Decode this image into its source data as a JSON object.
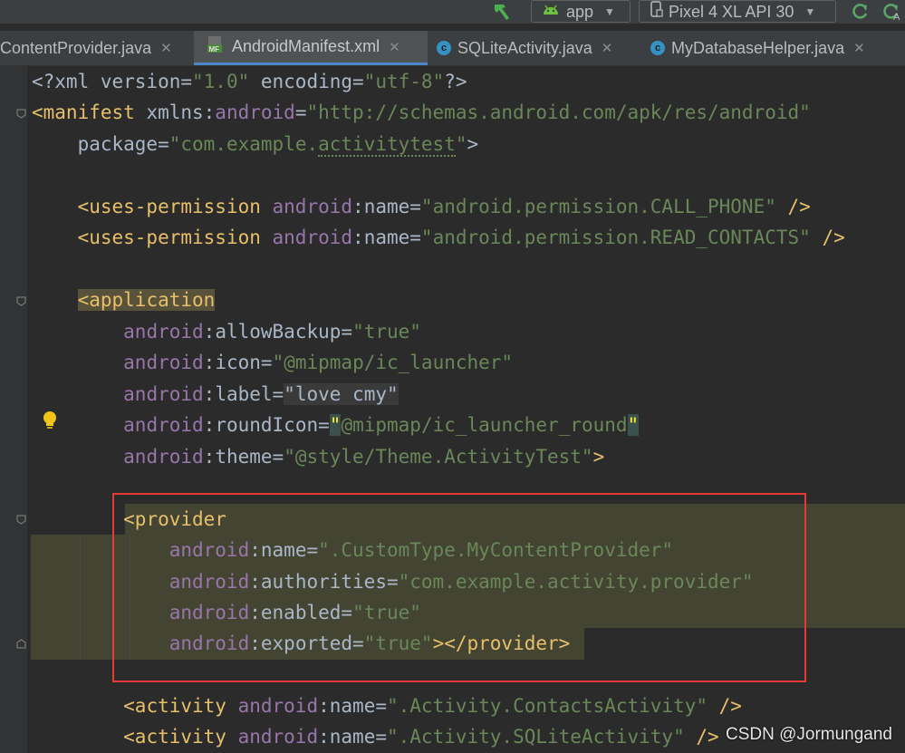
{
  "toolbar": {
    "run_config": "app",
    "device": "Pixel 4 XL API 30"
  },
  "tabs": [
    {
      "label": "ContentProvider.java",
      "icon": "class-icon"
    },
    {
      "label": "AndroidManifest.xml",
      "icon": "manifest-icon"
    },
    {
      "label": "SQLiteActivity.java",
      "icon": "class-icon"
    },
    {
      "label": "MyDatabaseHelper.java",
      "icon": "class-icon"
    }
  ],
  "code": {
    "l1": {
      "open": "<?xml ",
      "attrs": "version=",
      "v1": "\"1.0\"",
      "sp": " encoding=",
      "v2": "\"utf-8\"",
      "close": "?>"
    },
    "l2": {
      "tag": "<manifest ",
      "ns": "xmlns:",
      "android": "android",
      "eq": "=",
      "val": "\"http://schemas.android.com/apk/res/android\""
    },
    "l3": {
      "attr": "package",
      "eq": "=",
      "q": "\"com.example.",
      "pkg": "activitytest",
      "q2": "\"",
      "close": ">"
    },
    "l5": {
      "tag": "<uses-permission ",
      "ns": "android",
      "colon": ":",
      "attr": "name",
      "eq": "=",
      "val": "\"android.permission.CALL_PHONE\"",
      "close": " />"
    },
    "l6": {
      "tag": "<uses-permission ",
      "ns": "android",
      "colon": ":",
      "attr": "name",
      "eq": "=",
      "val": "\"android.permission.READ_CONTACTS\"",
      "close": " />"
    },
    "l8": {
      "lt": "<",
      "tag": "application"
    },
    "l9": {
      "ns": "android",
      "colon": ":",
      "attr": "allowBackup",
      "eq": "=",
      "val": "\"true\""
    },
    "l10": {
      "ns": "android",
      "colon": ":",
      "attr": "icon",
      "eq": "=",
      "val": "\"@mipmap/ic_launcher\""
    },
    "l11": {
      "ns": "android",
      "colon": ":",
      "attr": "label",
      "eq": "=",
      "val": "\"love cmy\""
    },
    "l12": {
      "ns": "android",
      "colon": ":",
      "attr": "roundIcon",
      "eq": "=",
      "q": "\"",
      "val": "@mipmap/ic_launcher_round",
      "q2": "\""
    },
    "l13": {
      "ns": "android",
      "colon": ":",
      "attr": "theme",
      "eq": "=",
      "val": "\"@style/Theme.ActivityTest\"",
      "close": ">"
    },
    "l15": {
      "tag": "<provider"
    },
    "l16": {
      "ns": "android",
      "colon": ":",
      "attr": "name",
      "eq": "=",
      "val": "\".CustomType.MyContentProvider\""
    },
    "l17": {
      "ns": "android",
      "colon": ":",
      "attr": "authorities",
      "eq": "=",
      "val": "\"com.example.activity.provider\""
    },
    "l18": {
      "ns": "android",
      "colon": ":",
      "attr": "enabled",
      "eq": "=",
      "val": "\"true\""
    },
    "l19": {
      "ns": "android",
      "colon": ":",
      "attr": "exported",
      "eq": "=",
      "val": "\"true\"",
      "close": "></provider>"
    },
    "l21": {
      "tag": "<activity ",
      "ns": "android",
      "colon": ":",
      "attr": "name",
      "eq": "=",
      "val": "\".Activity.ContactsActivity\"",
      "close": " />"
    },
    "l22": {
      "tag": "<activity ",
      "ns": "android",
      "colon": ":",
      "attr": "name",
      "eq": "=",
      "val": "\".Activity.SQLiteActivity\"",
      "close": " />"
    }
  },
  "watermark": "CSDN @Jormungand",
  "colors": {
    "tag": "#e8bf6a",
    "namespace": "#9876aa",
    "string": "#6a8759",
    "plain": "#a9b7c6",
    "highlight_box": "#e53935"
  }
}
